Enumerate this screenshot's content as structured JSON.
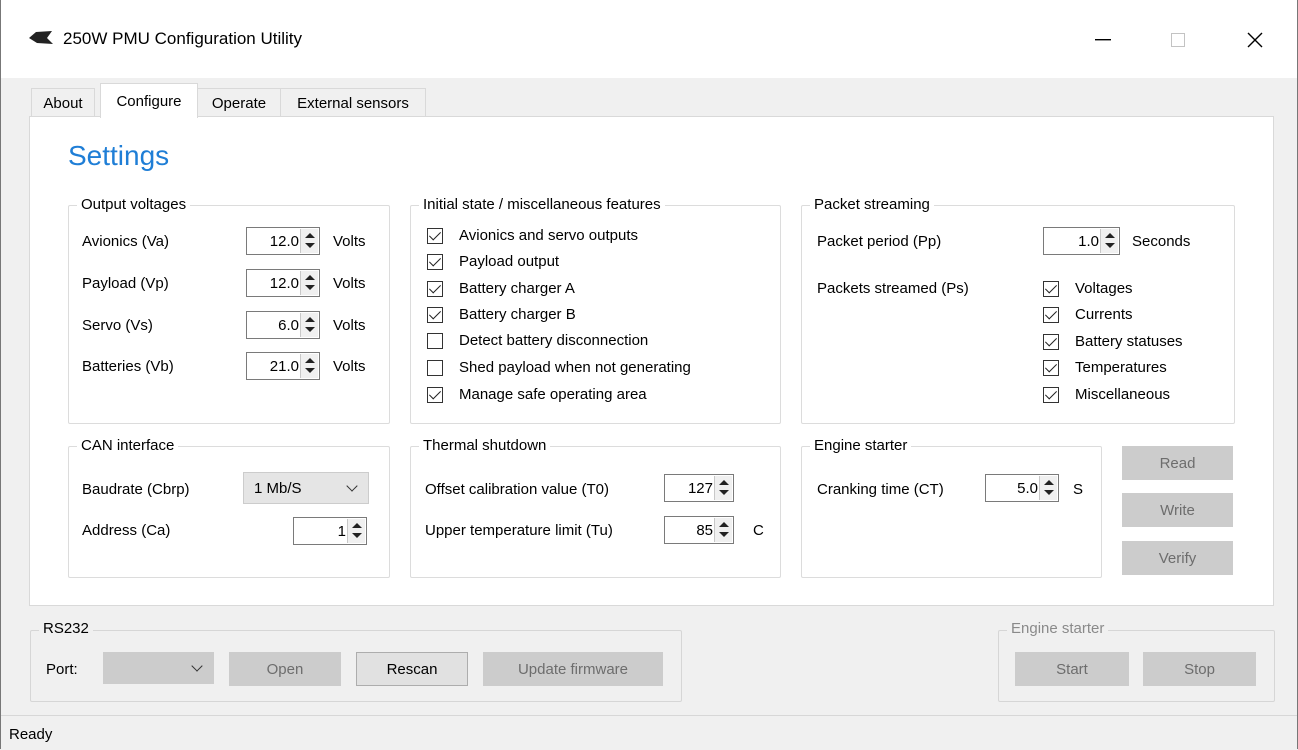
{
  "window": {
    "title": "250W PMU Configuration Utility"
  },
  "tabs": [
    {
      "label": "About",
      "active": false
    },
    {
      "label": "Configure",
      "active": true
    },
    {
      "label": "Operate",
      "active": false
    },
    {
      "label": "External sensors",
      "active": false
    }
  ],
  "settings_heading": "Settings",
  "output_voltages": {
    "title": "Output voltages",
    "unit": "Volts",
    "rows": [
      {
        "label": "Avionics (Va)",
        "value": "12.0"
      },
      {
        "label": "Payload (Vp)",
        "value": "12.0"
      },
      {
        "label": "Servo (Vs)",
        "value": "6.0"
      },
      {
        "label": "Batteries (Vb)",
        "value": "21.0"
      }
    ]
  },
  "initial_state": {
    "title": "Initial state / miscellaneous features",
    "items": [
      {
        "label": "Avionics and servo outputs",
        "checked": true
      },
      {
        "label": "Payload output",
        "checked": true
      },
      {
        "label": "Battery charger A",
        "checked": true
      },
      {
        "label": "Battery charger B",
        "checked": true
      },
      {
        "label": "Detect battery disconnection",
        "checked": false
      },
      {
        "label": "Shed payload when not generating",
        "checked": false
      },
      {
        "label": "Manage safe operating area",
        "checked": true
      }
    ]
  },
  "packet_streaming": {
    "title": "Packet streaming",
    "period_label": "Packet period (Pp)",
    "period_value": "1.0",
    "period_unit": "Seconds",
    "streamed_label": "Packets streamed (Ps)",
    "items": [
      {
        "label": "Voltages",
        "checked": true
      },
      {
        "label": "Currents",
        "checked": true
      },
      {
        "label": "Battery statuses",
        "checked": true
      },
      {
        "label": "Temperatures",
        "checked": true
      },
      {
        "label": "Miscellaneous",
        "checked": true
      }
    ]
  },
  "can_interface": {
    "title": "CAN interface",
    "baudrate_label": "Baudrate (Cbrp)",
    "baudrate_value": "1 Mb/S",
    "address_label": "Address (Ca)",
    "address_value": "1"
  },
  "thermal_shutdown": {
    "title": "Thermal shutdown",
    "offset_label": "Offset calibration value (T0)",
    "offset_value": "127",
    "upper_label": "Upper temperature limit (Tu)",
    "upper_value": "85",
    "upper_unit": "C"
  },
  "engine_starter_config": {
    "title": "Engine starter",
    "cranking_label": "Cranking time (CT)",
    "cranking_value": "5.0",
    "cranking_unit": "S"
  },
  "action_buttons": {
    "read": "Read",
    "write": "Write",
    "verify": "Verify"
  },
  "rs232": {
    "title": "RS232",
    "port_label": "Port:",
    "port_value": "",
    "open": "Open",
    "rescan": "Rescan",
    "update_firmware": "Update firmware"
  },
  "engine_starter_control": {
    "title": "Engine starter",
    "start": "Start",
    "stop": "Stop"
  },
  "status": "Ready"
}
